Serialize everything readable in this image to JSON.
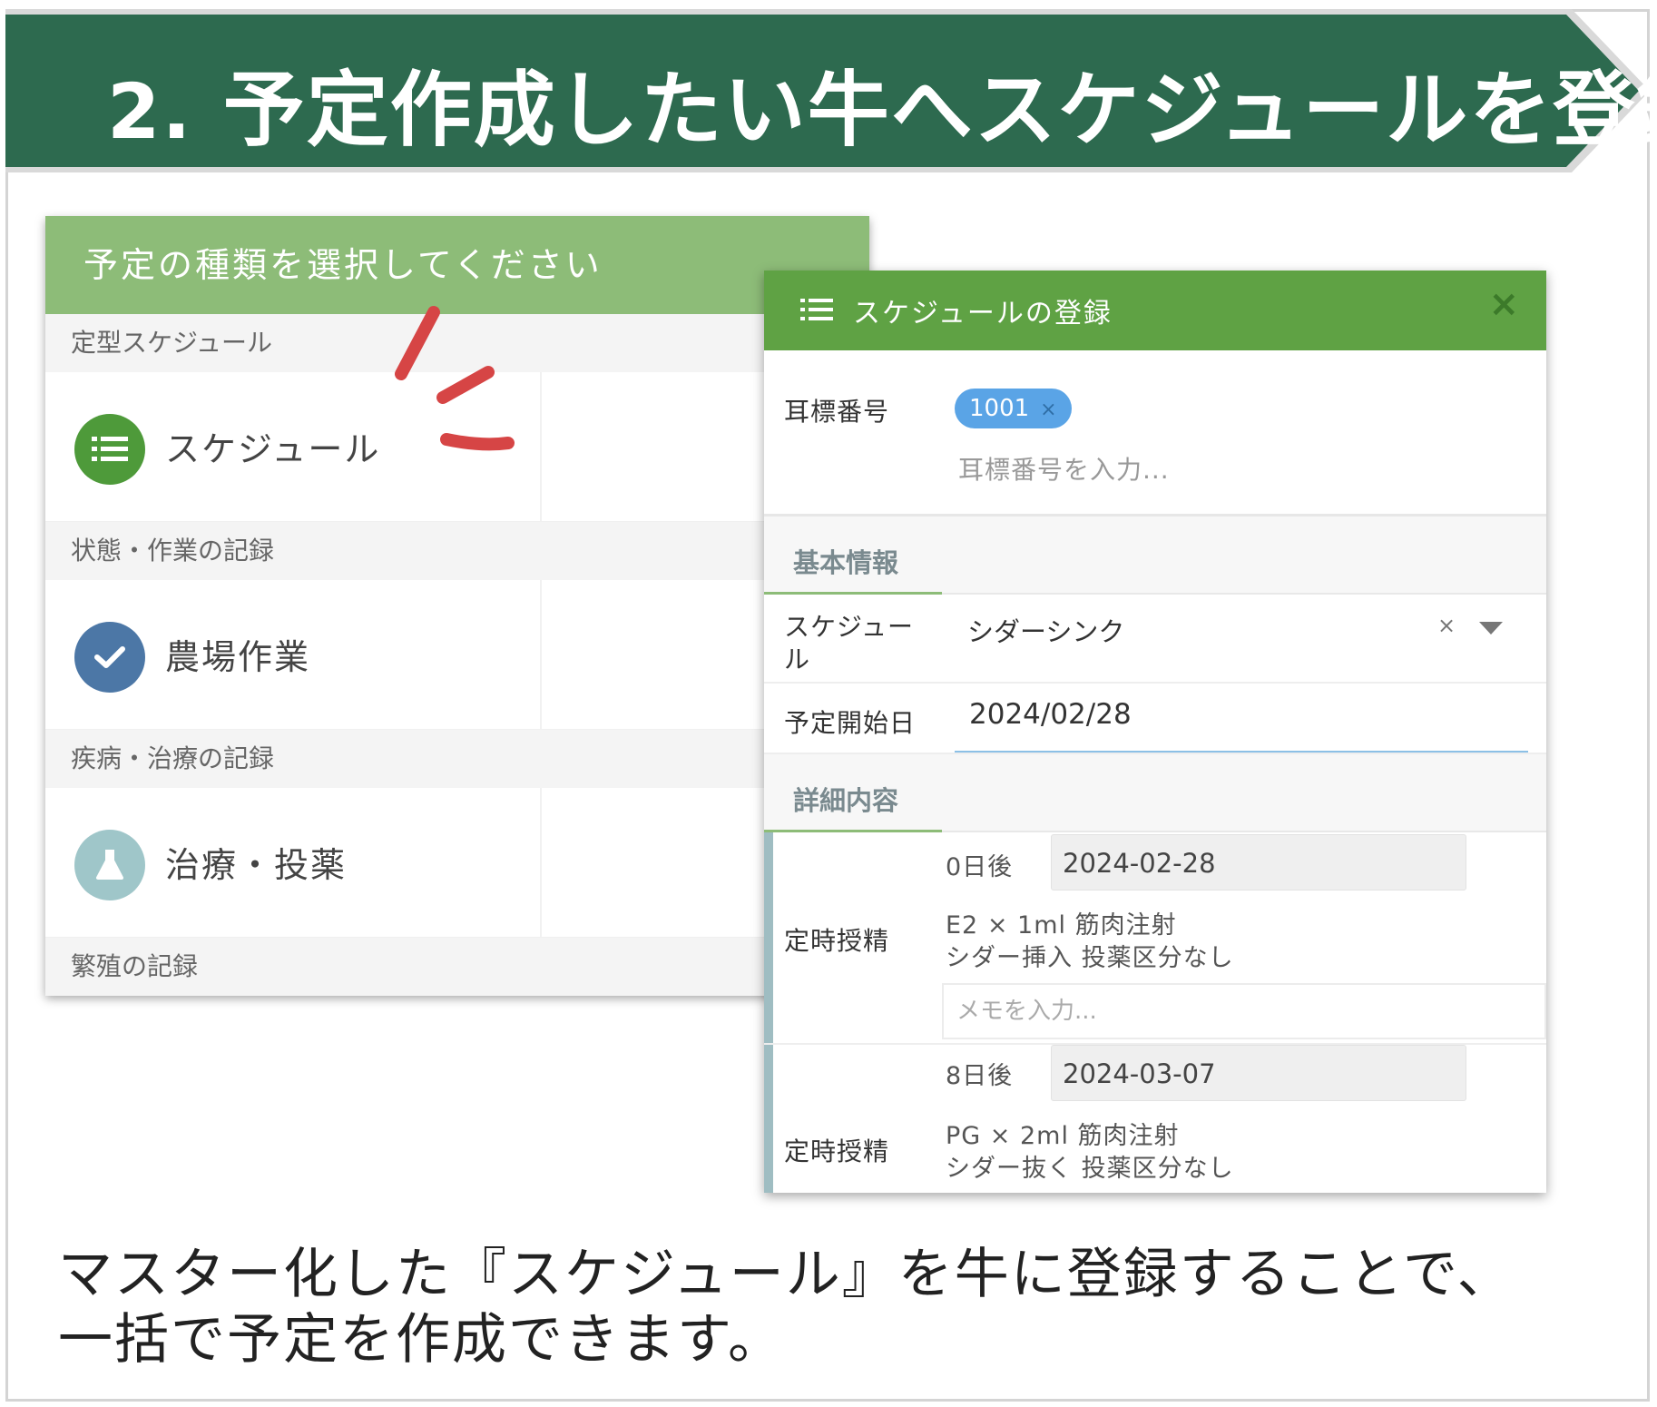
{
  "banner": {
    "number": "2.",
    "title": "予定作成したい牛へスケジュールを登録",
    "color": "#2d6a4f"
  },
  "type_selector": {
    "header": "予定の種類を選択してください",
    "sections": [
      {
        "label": "定型スケジュール",
        "item": "スケジュール",
        "icon": "list-icon",
        "icon_color": "#4e9a3a"
      },
      {
        "label": "状態・作業の記録",
        "item": "農場作業",
        "icon": "check-icon",
        "icon_color": "#4c77a6"
      },
      {
        "label": "疾病・治療の記録",
        "item": "治療・投薬",
        "icon": "flask-icon",
        "icon_color": "#9fc6c9"
      },
      {
        "label": "繁殖の記録"
      }
    ]
  },
  "schedule_modal": {
    "title": "スケジュールの登録",
    "close": "×",
    "ear_tag": {
      "label": "耳標番号",
      "tag": "1001",
      "tag_remove": "×",
      "placeholder": "耳標番号を入力..."
    },
    "basic_info": {
      "heading": "基本情報",
      "schedule_label": "スケジュー\nル",
      "schedule_value": "シダーシンク",
      "clear": "×",
      "start_label": "予定開始日",
      "start_value": "2024/02/28"
    },
    "details": {
      "heading": "詳細内容",
      "entries": [
        {
          "name": "定時授精",
          "offset": "0日後",
          "date": "2024-02-28",
          "line1": "E2 × 1ml 筋肉注射",
          "line2": "シダー挿入  投薬区分なし",
          "memo_placeholder": "メモを入力..."
        },
        {
          "name": "定時授精",
          "offset": "8日後",
          "date": "2024-03-07",
          "line1": "PG × 2ml 筋肉注射",
          "line2": "シダー抜く  投薬区分なし"
        }
      ]
    }
  },
  "caption": {
    "line1": "マスター化した『スケジュール』を牛に登録することで、",
    "line2": "一括で予定を作成できます。"
  }
}
